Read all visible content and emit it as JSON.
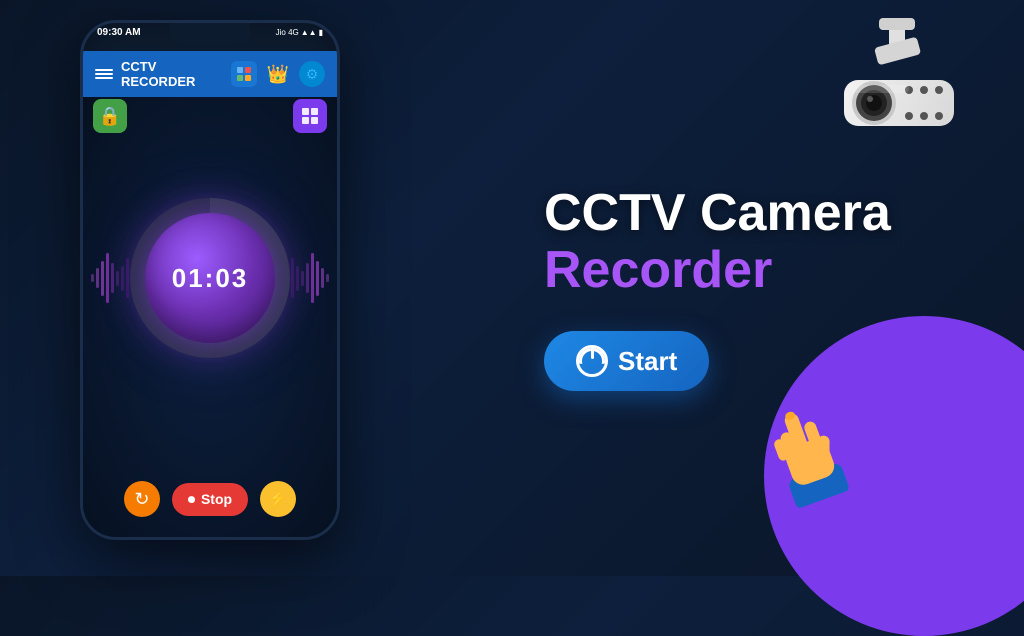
{
  "app": {
    "title": "CCTV RECORDER",
    "tagline_white": "CCTV Camera",
    "tagline_purple": "Recorder",
    "start_button_label": "Start",
    "stop_button_label": "Stop"
  },
  "phone": {
    "status_time": "09:30 AM",
    "status_carrier": "Jio 4G",
    "timer_display": "01:03"
  },
  "icons": {
    "power_icon": "⏻",
    "record_dot": "⏺",
    "refresh": "↻",
    "bolt": "⚡",
    "camera": "📷",
    "crown": "👑",
    "settings": "⚙️",
    "lock": "🔒",
    "grid": "⊞"
  },
  "colors": {
    "accent_blue": "#1e88e5",
    "accent_purple": "#a855f7",
    "stop_red": "#e53935",
    "bg_dark": "#0a1628"
  }
}
